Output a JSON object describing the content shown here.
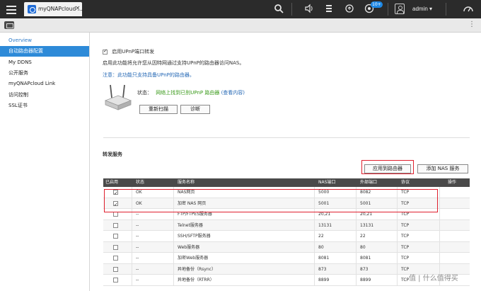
{
  "topbar": {
    "app_tab_title": "myQNAPcloud ...",
    "close_glyph": "×",
    "notification_count": "10+",
    "username": "admin ▾"
  },
  "sidebar": {
    "items": [
      {
        "label": "Overview"
      },
      {
        "label": "自动路由器配置"
      },
      {
        "label": "My DDNS"
      },
      {
        "label": "公开服务"
      },
      {
        "label": "myQNAPcloud Link"
      },
      {
        "label": "访问控制"
      },
      {
        "label": "SSL证书"
      }
    ]
  },
  "upnp": {
    "enable_label": "启用UPnP端口转发",
    "description": "启用此功能将允许您从因特网通过支持UPnP的路由器访问NAS。",
    "note": "注意：此功能只支持具备UPnP的路由器。",
    "status_label": "状态：",
    "status_text": "网络上找到已别UPnP 路由器",
    "status_link": "(查看内容)",
    "rescan_button": "重新扫描",
    "diagnose_button": "诊断"
  },
  "forwarding": {
    "section_title": "转发服务",
    "apply_button": "应用到路由器",
    "add_button": "添加 NAS 服务",
    "columns": [
      "已启用",
      "状态",
      "服务名称",
      "NAS端口",
      "外部端口",
      "协议",
      "操作"
    ],
    "rows": [
      {
        "enabled": true,
        "status": "OK",
        "name": "NAS网页",
        "nas_port": "5000",
        "ext_port": "8082",
        "protocol": "TCP"
      },
      {
        "enabled": true,
        "status": "OK",
        "name": "加密 NAS 网页",
        "nas_port": "5001",
        "ext_port": "5001",
        "protocol": "TCP"
      },
      {
        "enabled": false,
        "status": "--",
        "name": "FTP/FTPES服务器",
        "nas_port": "20,21",
        "ext_port": "20,21",
        "protocol": "TCP"
      },
      {
        "enabled": false,
        "status": "--",
        "name": "Telnet服务器",
        "nas_port": "13131",
        "ext_port": "13131",
        "protocol": "TCP"
      },
      {
        "enabled": false,
        "status": "--",
        "name": "SSH/SFTP服务器",
        "nas_port": "22",
        "ext_port": "22",
        "protocol": "TCP"
      },
      {
        "enabled": false,
        "status": "--",
        "name": "Web服务器",
        "nas_port": "80",
        "ext_port": "80",
        "protocol": "TCP"
      },
      {
        "enabled": false,
        "status": "--",
        "name": "加密Web服务器",
        "nas_port": "8081",
        "ext_port": "8081",
        "protocol": "TCP"
      },
      {
        "enabled": false,
        "status": "--",
        "name": "异地备份（Rsync）",
        "nas_port": "873",
        "ext_port": "873",
        "protocol": "TCP"
      },
      {
        "enabled": false,
        "status": "--",
        "name": "异地备份（RTRR）",
        "nas_port": "8899",
        "ext_port": "8899",
        "protocol": "TCP"
      }
    ]
  },
  "watermark": "值 | 什么值得买",
  "colors": {
    "accent": "#2d8ad8",
    "highlight": "#e0202e",
    "status_ok": "#3a9a1a"
  }
}
